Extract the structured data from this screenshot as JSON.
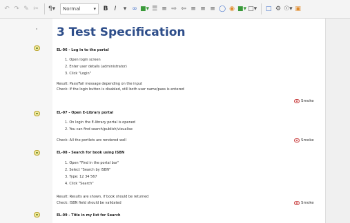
{
  "toolbar": {
    "style_value": "Normal",
    "items": [
      "undo-icon",
      "redo-icon",
      "format-paint-icon",
      "bold-icon",
      "italic-icon",
      "link-icon",
      "image-icon",
      "list-numbered-icon",
      "list-bullet-icon",
      "indent-icon",
      "outdent-icon",
      "align-left-icon",
      "align-center-icon",
      "align-right-icon",
      "table-icon",
      "tag-icon",
      "color-icon",
      "insert-icon",
      "window-icon",
      "settings-icon",
      "web-icon",
      "expand-icon"
    ]
  },
  "document": {
    "title": "3 Test Specification",
    "cases": [
      {
        "id": "EL-06 - Log in to the portal",
        "steps": [
          "1. Open login screen",
          "2. Enter user details (administrator)",
          "3. Click \"Login\""
        ],
        "result": "Result: Pass/Fail message depending on the input",
        "check": "Check: If the login button is disabled, still both user name/pass is entered",
        "tag": "Smoke"
      },
      {
        "id": "EL-07 - Open E-Library portal",
        "steps": [
          "1. On login the E-library portal is opened",
          "2. You can find search/publish/visualise"
        ],
        "check": "Check: All the portlets are rendered well",
        "tag": "Smoke"
      },
      {
        "id": "EL-08 - Search for book using ISBN",
        "steps": [
          "1. Open \"Find in the portal bar\"",
          "2. Select \"Search by ISBN\"",
          "3. Type: 12 34 567",
          "4. Click \"Search\""
        ],
        "result": "Result: Results are shown, if book should be returned",
        "check": "Check: ISBN field should be validated",
        "tag": "Smoke"
      },
      {
        "id": "EL-09 - Title in my list for Search"
      }
    ]
  },
  "colors": {
    "title": "#2e4e8a",
    "tag": "#c84040"
  }
}
